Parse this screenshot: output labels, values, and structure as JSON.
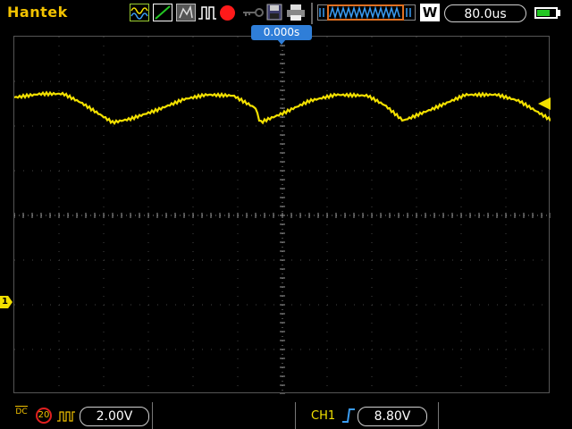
{
  "brand": "Hantek",
  "timebase": "80.0us",
  "trigger_position": "0.000s",
  "channel_marker": "1",
  "mode_letter": "W",
  "colors": {
    "brand": "#f2c200",
    "trace": "#f2e000",
    "trigger_tag": "#2f7ed8",
    "run": "#ff1a1a",
    "battery": "#23c823"
  },
  "battery_level": 0.7,
  "icons": [
    "waveform-icon",
    "ramp-icon",
    "persist-icon",
    "pulse-icon",
    "run-indicator-icon",
    "key-icon",
    "save-icon",
    "printer-icon",
    "memory-depth-icon",
    "mode-icon",
    "battery-icon"
  ],
  "bottom": {
    "coupling": "DC",
    "bandwidth_limit": "20",
    "volts_per_div": "2.00V",
    "trigger_source": "CH1",
    "trigger_level": "8.80V"
  }
}
